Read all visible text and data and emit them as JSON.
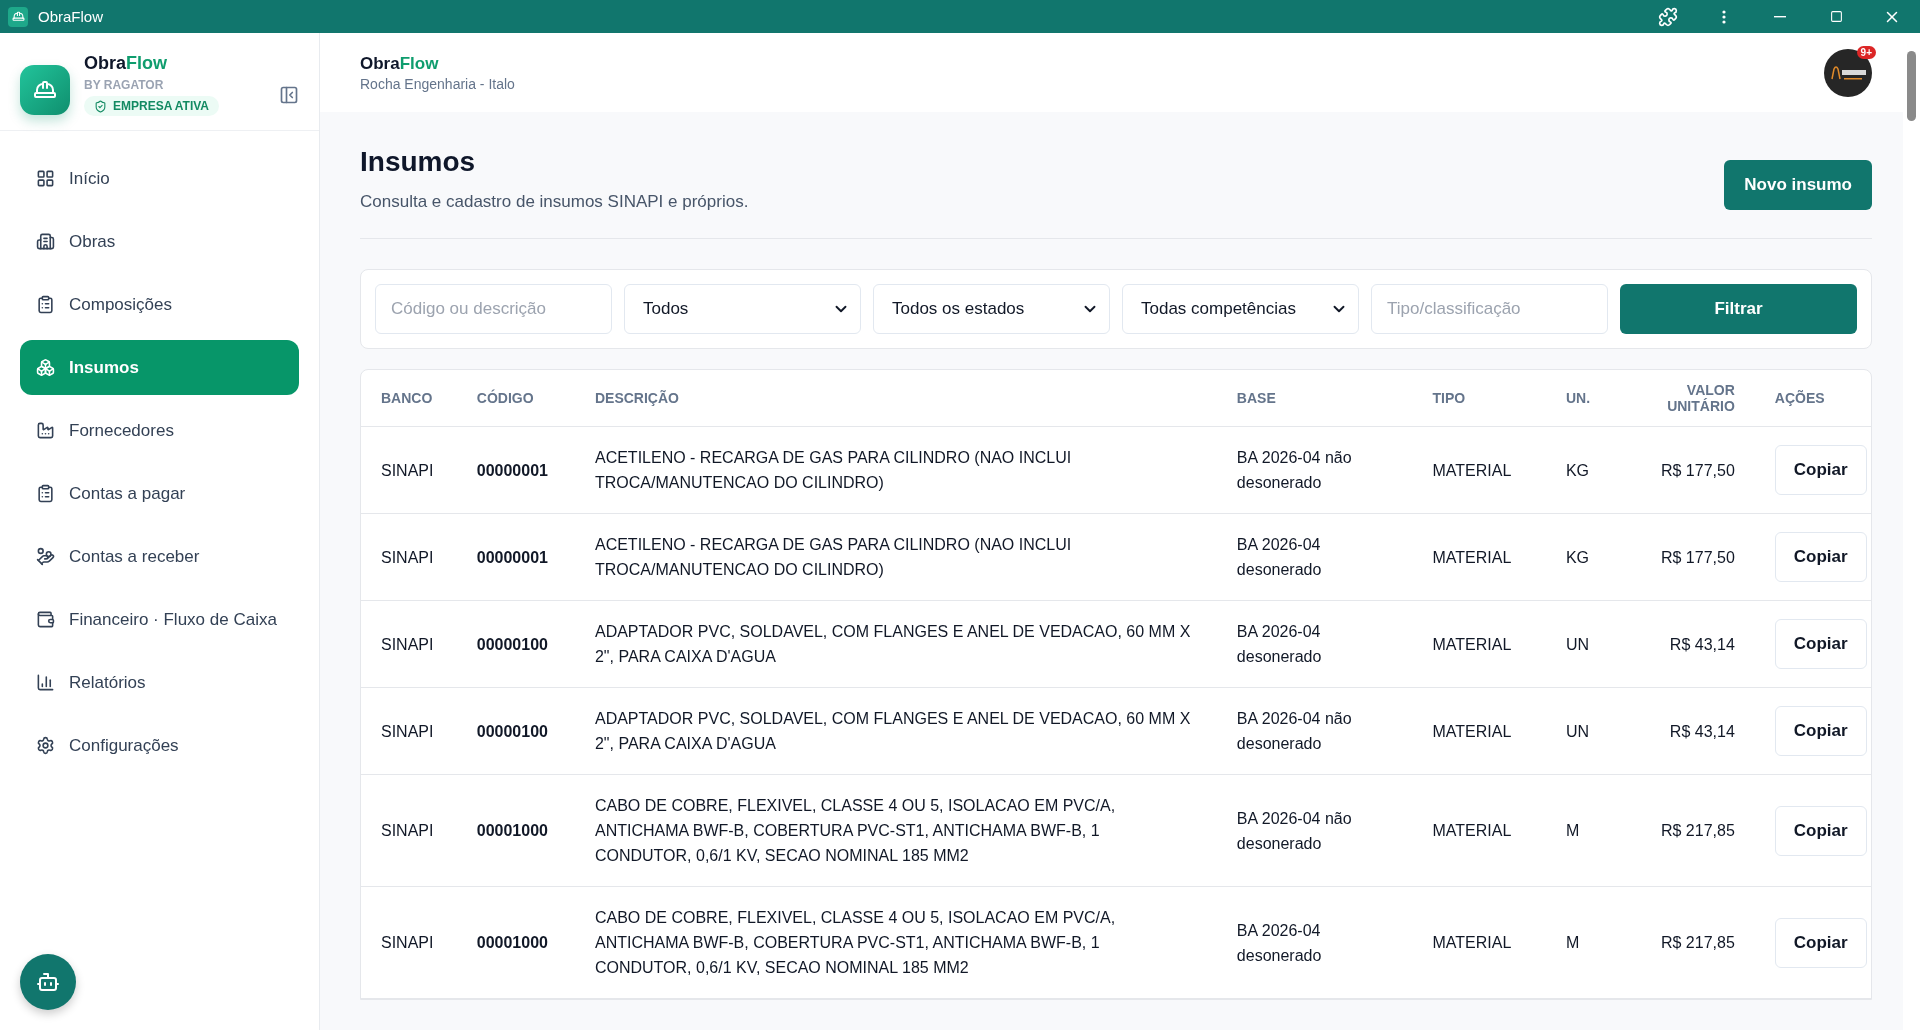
{
  "window": {
    "title": "ObraFlow"
  },
  "brand": {
    "name_a": "Obra",
    "name_b": "Flow",
    "by": "BY RAGATOR",
    "status": "EMPRESA ATIVA"
  },
  "sidebar": {
    "items": [
      {
        "label": "Início",
        "selected": false
      },
      {
        "label": "Obras",
        "selected": false
      },
      {
        "label": "Composições",
        "selected": false
      },
      {
        "label": "Insumos",
        "selected": true
      },
      {
        "label": "Fornecedores",
        "selected": false
      },
      {
        "label": "Contas a pagar",
        "selected": false
      },
      {
        "label": "Contas a receber",
        "selected": false
      },
      {
        "label": "Financeiro · Fluxo de Caixa",
        "selected": false
      },
      {
        "label": "Relatórios",
        "selected": false
      },
      {
        "label": "Configurações",
        "selected": false
      }
    ]
  },
  "header": {
    "name_a": "Obra",
    "name_b": "Flow",
    "company": "Rocha Engenharia - Italo",
    "avatar_badge": "9+"
  },
  "page": {
    "title": "Insumos",
    "subtitle": "Consulta e cadastro de insumos SINAPI e próprios.",
    "new_button": "Novo insumo"
  },
  "filters": [
    {
      "kind": "input",
      "placeholder": "Código ou descrição"
    },
    {
      "kind": "select",
      "value": "Todos"
    },
    {
      "kind": "select",
      "value": "Todos os estados"
    },
    {
      "kind": "select",
      "value": "Todas competências"
    },
    {
      "kind": "input",
      "placeholder": "Tipo/classificação"
    }
  ],
  "filter_button": "Filtrar",
  "table": {
    "columns": [
      "BANCO",
      "CÓDIGO",
      "DESCRIÇÃO",
      "BASE",
      "TIPO",
      "UN.",
      "VALOR UNITÁRIO",
      "AÇÕES"
    ],
    "rows": [
      {
        "banco": "SINAPI",
        "codigo": "00000001",
        "descricao": "ACETILENO - RECARGA DE GAS PARA CILINDRO (NAO INCLUI TROCA/MANUTENCAO DO CILINDRO)",
        "base": "BA 2026-04 não desonerado",
        "tipo": "MATERIAL",
        "un": "KG",
        "valor": "R$ 177,50",
        "action": "Copiar"
      },
      {
        "banco": "SINAPI",
        "codigo": "00000001",
        "descricao": "ACETILENO - RECARGA DE GAS PARA CILINDRO (NAO INCLUI TROCA/MANUTENCAO DO CILINDRO)",
        "base": "BA 2026-04 desonerado",
        "tipo": "MATERIAL",
        "un": "KG",
        "valor": "R$ 177,50",
        "action": "Copiar"
      },
      {
        "banco": "SINAPI",
        "codigo": "00000100",
        "descricao": "ADAPTADOR PVC, SOLDAVEL, COM FLANGES E ANEL DE VEDACAO, 60 MM X 2\", PARA CAIXA D'AGUA",
        "base": "BA 2026-04 desonerado",
        "tipo": "MATERIAL",
        "un": "UN",
        "valor": "R$ 43,14",
        "action": "Copiar"
      },
      {
        "banco": "SINAPI",
        "codigo": "00000100",
        "descricao": "ADAPTADOR PVC, SOLDAVEL, COM FLANGES E ANEL DE VEDACAO, 60 MM X 2\", PARA CAIXA D'AGUA",
        "base": "BA 2026-04 não desonerado",
        "tipo": "MATERIAL",
        "un": "UN",
        "valor": "R$ 43,14",
        "action": "Copiar"
      },
      {
        "banco": "SINAPI",
        "codigo": "00001000",
        "descricao": "CABO DE COBRE, FLEXIVEL, CLASSE 4 OU 5, ISOLACAO EM PVC/A, ANTICHAMA BWF-B, COBERTURA PVC-ST1, ANTICHAMA BWF-B, 1 CONDUTOR, 0,6/1 KV, SECAO NOMINAL 185 MM2",
        "base": "BA 2026-04 não desonerado",
        "tipo": "MATERIAL",
        "un": "M",
        "valor": "R$ 217,85",
        "action": "Copiar"
      },
      {
        "banco": "SINAPI",
        "codigo": "00001000",
        "descricao": "CABO DE COBRE, FLEXIVEL, CLASSE 4 OU 5, ISOLACAO EM PVC/A, ANTICHAMA BWF-B, COBERTURA PVC-ST1, ANTICHAMA BWF-B, 1 CONDUTOR, 0,6/1 KV, SECAO NOMINAL 185 MM2",
        "base": "BA 2026-04 desonerado",
        "tipo": "MATERIAL",
        "un": "M",
        "valor": "R$ 217,85",
        "action": "Copiar"
      }
    ]
  }
}
